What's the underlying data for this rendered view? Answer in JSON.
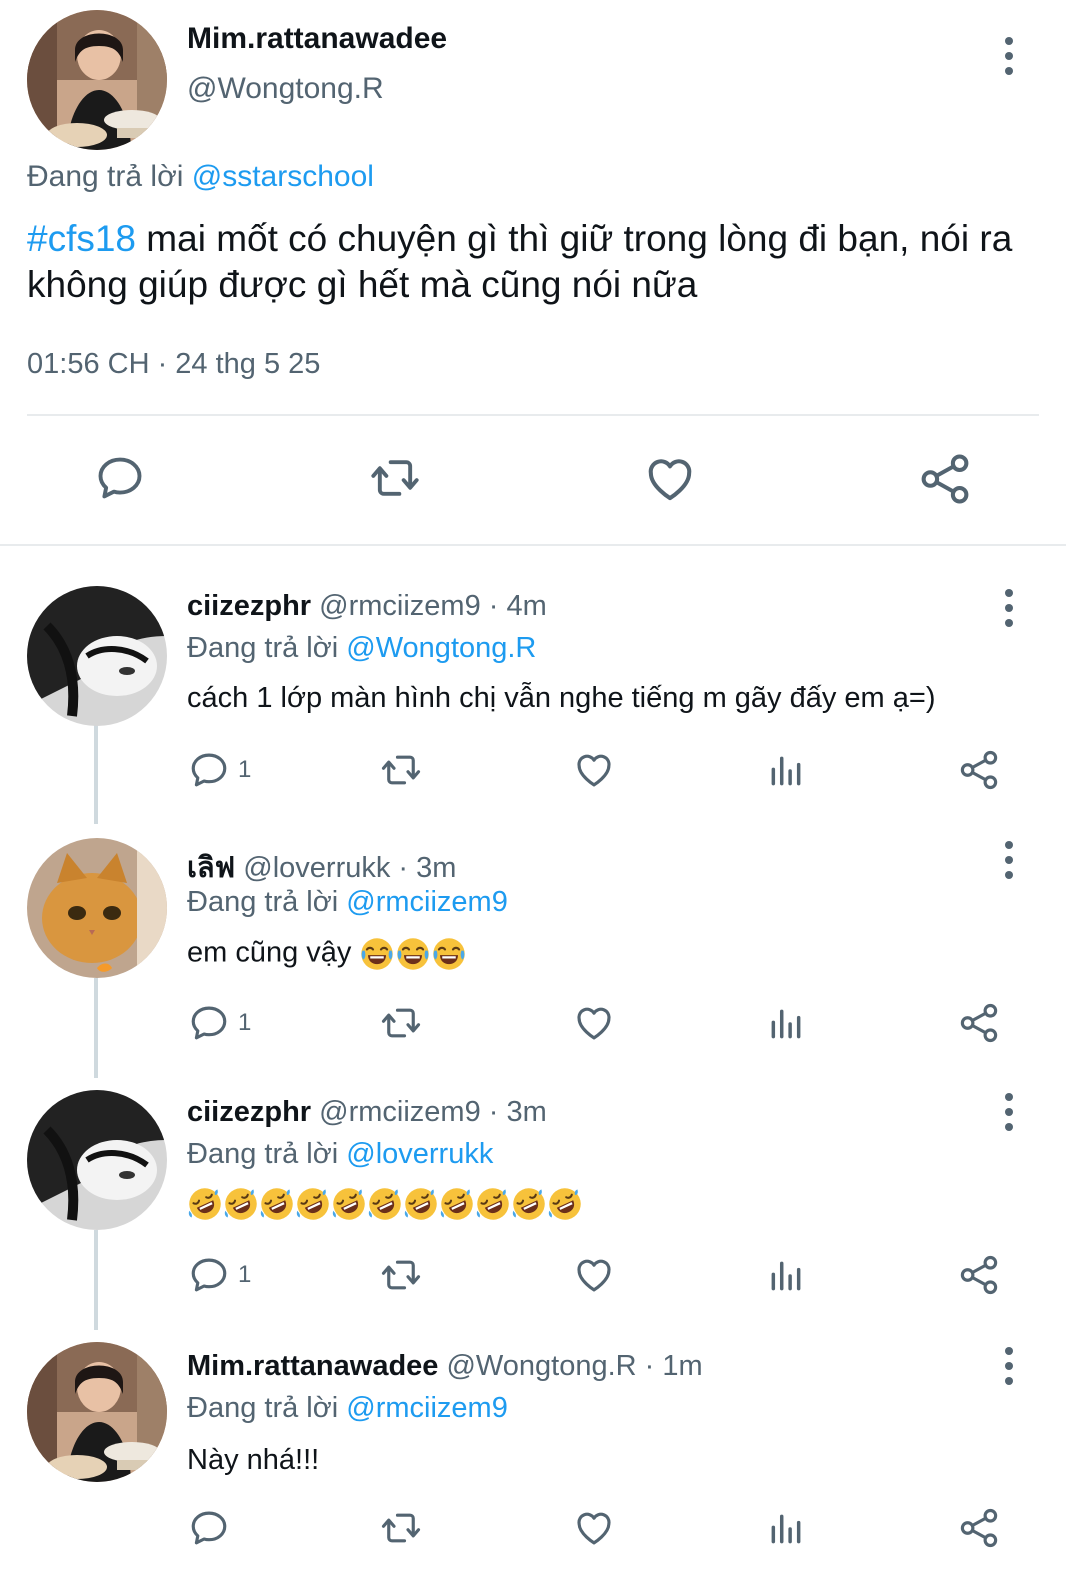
{
  "main_tweet": {
    "display_name": "Mim.rattanawadee",
    "handle": "@Wongtong.R",
    "replying_prefix": "Đang trả lời",
    "replying_to": "@sstarschool",
    "hashtag": "#cfs18",
    "text": " mai mốt có chuyện gì thì giữ trong lòng đi bạn, nói ra không giúp được gì hết mà cũng nói nữa",
    "timestamp": "01:56 CH · 24 thg 5 25"
  },
  "replies": [
    {
      "display_name": "ciizezphr",
      "meta": "@rmciizem9 · 4m",
      "replying_prefix": "Đang trả lời",
      "replying_to": "@Wongtong.R",
      "text": "cách 1 lớp màn hình chị vẫn nghe tiếng m gãy đấy em ạ=)",
      "reply_count": "1"
    },
    {
      "display_name": "เลิฟ",
      "meta": "@loverrukk · 3m",
      "replying_prefix": "Đang trả lời",
      "replying_to": "@rmciizem9",
      "text": "em cũng vậy",
      "emoji": "face-with-tears-of-joy",
      "emoji_count": 3,
      "reply_count": "1"
    },
    {
      "display_name": "ciizezphr",
      "meta": "@rmciizem9 · 3m",
      "replying_prefix": "Đang trả lời",
      "replying_to": "@loverrukk",
      "text": "",
      "emoji": "rolling-on-floor-laughing",
      "emoji_count": 11,
      "reply_count": "1"
    },
    {
      "display_name": "Mim.rattanawadee",
      "meta": "@Wongtong.R · 1m",
      "replying_prefix": "Đang trả lời",
      "replying_to": "@rmciizem9",
      "text": "Này nhá!!!",
      "reply_count": ""
    }
  ],
  "colors": {
    "link": "#1d9bf0",
    "secondary_text": "#536471",
    "primary_text": "#0f1419",
    "divider": "#e8ebed",
    "thread_line": "#cfd9de"
  },
  "icons": [
    "reply-icon",
    "retweet-icon",
    "like-icon",
    "views-icon",
    "share-icon",
    "more-icon"
  ]
}
